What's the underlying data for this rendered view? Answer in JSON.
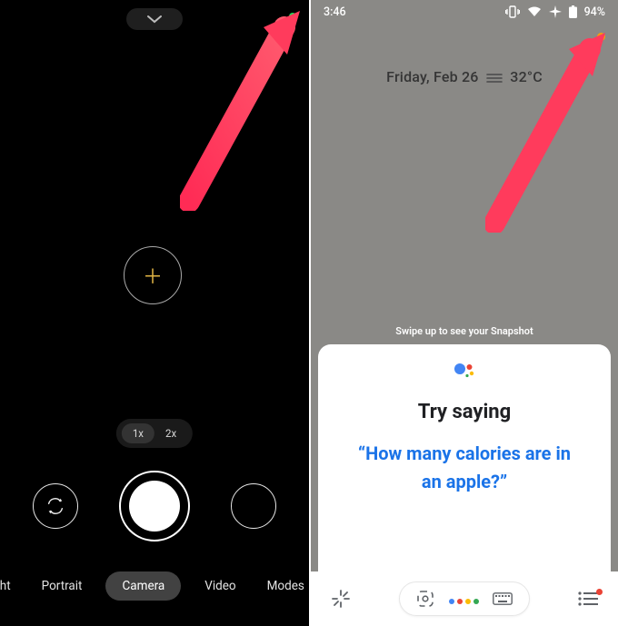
{
  "left": {
    "privacy_dot_color": "#1fd655",
    "zoom": {
      "options": [
        "1x",
        "2x"
      ],
      "selected": "1x"
    },
    "modes": {
      "items": [
        "t Sight",
        "Portrait",
        "Camera",
        "Video",
        "Modes"
      ],
      "selected_index": 2
    }
  },
  "right": {
    "status": {
      "time": "3:46",
      "battery": "94%"
    },
    "privacy_dot_color": "#f59e0b",
    "date": {
      "day": "Friday, Feb 26",
      "temp": "32°C"
    },
    "snapshot_hint": "Swipe up to see your Snapshot",
    "assistant": {
      "heading": "Try saying",
      "phrase": "“How many calories are in an apple?”"
    }
  }
}
